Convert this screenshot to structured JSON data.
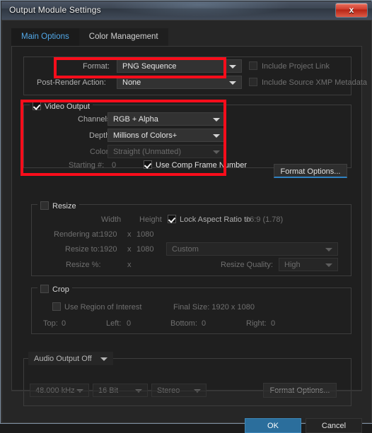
{
  "window": {
    "title": "Output Module Settings",
    "close_icon": "close-x-icon",
    "close_label": "x"
  },
  "tabs": [
    {
      "label": "Main Options",
      "active": true
    },
    {
      "label": "Color Management",
      "active": false
    }
  ],
  "format_section": {
    "format_label": "Format:",
    "format_value": "PNG Sequence",
    "post_render_label": "Post-Render Action:",
    "post_render_value": "None",
    "include_project_link_label": "Include Project Link",
    "include_project_link_checked": false,
    "include_xmp_label": "Include Source XMP Metadata",
    "include_xmp_checked": false
  },
  "video_output": {
    "group_label": "Video Output",
    "group_checked": true,
    "channels_label": "Channels:",
    "channels_value": "RGB + Alpha",
    "depth_label": "Depth:",
    "depth_value": "Millions of Colors+",
    "color_label": "Color:",
    "color_value": "Straight (Unmatted)",
    "color_disabled": true,
    "starting_num_label": "Starting #:",
    "starting_num_value": "0",
    "use_comp_frame_label": "Use Comp Frame Number",
    "use_comp_frame_checked": true,
    "format_options_label": "Format Options..."
  },
  "resize": {
    "group_label": "Resize",
    "group_checked": false,
    "width_header": "Width",
    "height_header": "Height",
    "lock_aspect_label": "Lock Aspect Ratio to",
    "lock_aspect_value": "16:9 (1.78)",
    "lock_aspect_checked": true,
    "rendering_at_label": "Rendering at:",
    "rendering_at_width": "1920",
    "rendering_at_x": "x",
    "rendering_at_height": "1080",
    "resize_to_label": "Resize to:",
    "resize_to_width": "1920",
    "resize_to_x": "x",
    "resize_to_height": "1080",
    "resize_preset_value": "Custom",
    "resize_pct_label": "Resize %:",
    "resize_pct_x": "x",
    "resize_quality_label": "Resize Quality:",
    "resize_quality_value": "High"
  },
  "crop": {
    "group_label": "Crop",
    "group_checked": false,
    "use_roi_label": "Use Region of Interest",
    "use_roi_checked": false,
    "final_size_label": "Final Size: 1920 x 1080",
    "top_label": "Top:",
    "top_value": "0",
    "left_label": "Left:",
    "left_value": "0",
    "bottom_label": "Bottom:",
    "bottom_value": "0",
    "right_label": "Right:",
    "right_value": "0"
  },
  "audio": {
    "output_toggle_value": "Audio Output Off",
    "sample_rate_value": "48.000 kHz",
    "bit_depth_value": "16 Bit",
    "channels_value": "Stereo",
    "format_options_label": "Format Options..."
  },
  "footer": {
    "ok_label": "OK",
    "cancel_label": "Cancel"
  },
  "annotations": {
    "accent_color": "#fb0d1b",
    "boxes": [
      {
        "name": "format-highlight"
      },
      {
        "name": "video-output-highlight"
      }
    ]
  }
}
